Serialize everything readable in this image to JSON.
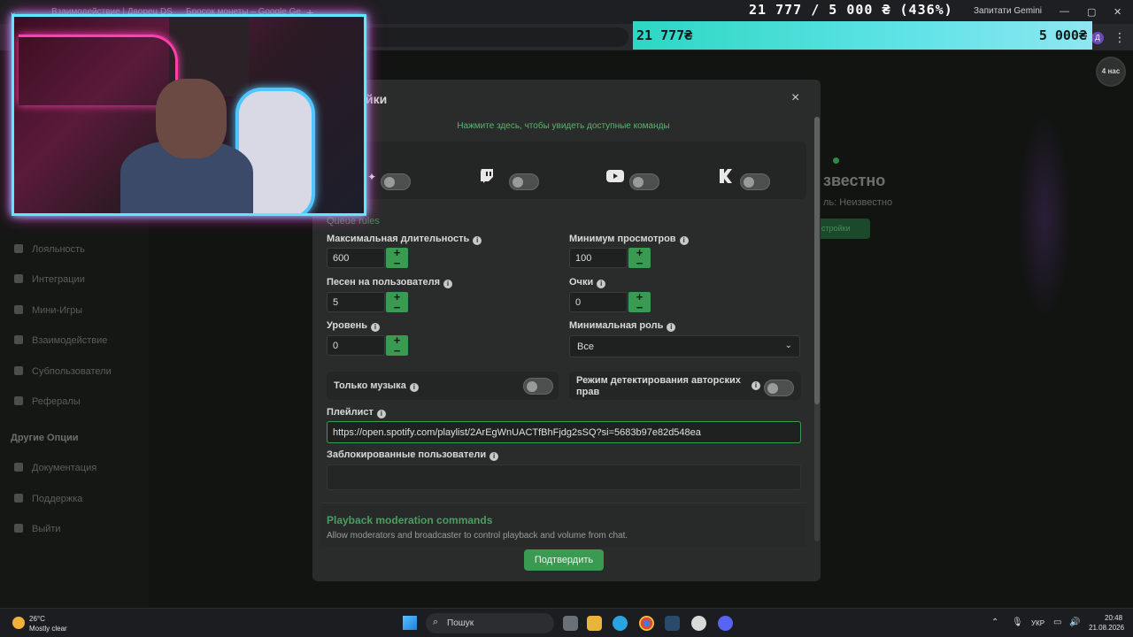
{
  "browser": {
    "tabs": [
      {
        "title": "Взаимодействие | Дворец DS"
      },
      {
        "title": "Бросок монеты – Google Ge"
      }
    ],
    "new_tab": "+",
    "gemini_label": "Запитати Gemini",
    "profile_initial": "Д",
    "window_controls": [
      "—",
      "▢",
      "✕"
    ]
  },
  "goal": {
    "title": "21 777 / 5 000 ₴ (436%)",
    "current": "21 777₴",
    "target": "5 000₴",
    "progress_percent": 436,
    "bar_color": "#2cd7c3"
  },
  "sidebar": {
    "items": [
      {
        "label": "Лояльность"
      },
      {
        "label": "Интеграции"
      },
      {
        "label": "Мини-Игры"
      },
      {
        "label": "Взаимодействие"
      },
      {
        "label": "Субпользователи"
      },
      {
        "label": "Рефералы"
      }
    ],
    "section_other": "Другие Опции",
    "other_items": [
      {
        "label": "Документация"
      },
      {
        "label": "Поддержка"
      },
      {
        "label": "Выйти"
      }
    ]
  },
  "background": {
    "unknown_title": "звестно",
    "unknown_sub": "ль: Неизвестно",
    "green_button": "стройки",
    "corner_avatar": "4 нас"
  },
  "modal": {
    "title": "йки",
    "close": "×",
    "hint": "Нажмите здесь, чтобы увидеть доступные команды",
    "platforms": [
      {
        "icon": "kick-icon",
        "enabled": false
      },
      {
        "icon": "twitch-icon",
        "enabled": false
      },
      {
        "icon": "youtube-icon",
        "enabled": false
      },
      {
        "icon": "k-icon",
        "enabled": false
      }
    ],
    "queue_rules_label": "Queue rules",
    "fields": {
      "max_duration": {
        "label": "Максимальная длительность",
        "value": "600"
      },
      "min_views": {
        "label": "Минимум просмотров",
        "value": "100"
      },
      "songs_per_user": {
        "label": "Песен на пользователя",
        "value": "5"
      },
      "points": {
        "label": "Очки",
        "value": "0"
      },
      "level": {
        "label": "Уровень",
        "value": "0"
      },
      "min_role": {
        "label": "Минимальная роль",
        "value": "Все"
      }
    },
    "toggles": {
      "music_only": {
        "label": "Только музыка",
        "enabled": false
      },
      "copyright": {
        "label": "Режим детектирования авторских прав",
        "enabled": false
      }
    },
    "playlist": {
      "label": "Плейлист",
      "value": "https://open.spotify.com/playlist/2ArEgWnUACTfBhFjdg2sSQ?si=5683b97e82d548ea"
    },
    "blocked_users": {
      "label": "Заблокированные пользователи",
      "value": ""
    },
    "playback": {
      "title": "Playback moderation commands",
      "description": "Allow moderators and broadcaster to control playback and volume from chat."
    },
    "confirm": "Подтвердить",
    "accent_color": "#3a9a52"
  },
  "taskbar": {
    "weather_temp": "26°C",
    "weather_desc": "Mostly clear",
    "search_placeholder": "Пошук",
    "language": "УКР",
    "time": "20:48",
    "date": "21.08.2026"
  }
}
